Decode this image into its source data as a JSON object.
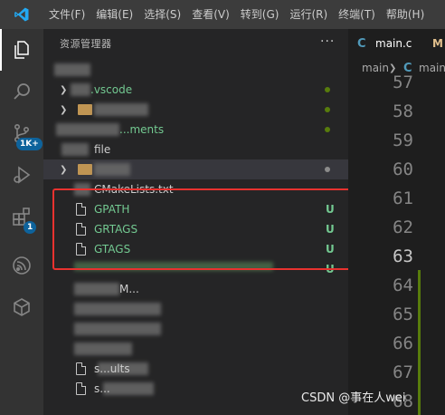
{
  "menubar": {
    "items": [
      "文件(F)",
      "编辑(E)",
      "选择(S)",
      "查看(V)",
      "转到(G)",
      "运行(R)",
      "终端(T)",
      "帮助(H)"
    ]
  },
  "activitybar": {
    "icons": [
      "explorer-icon",
      "search-icon",
      "source-control-icon",
      "run-debug-icon",
      "extensions-icon",
      "espressif-icon",
      "hexagon-icon"
    ],
    "scm_badge": "1K+",
    "extensions_badge": "1"
  },
  "sidebar": {
    "title": "资源管理器",
    "more": "···",
    "items": [
      {
        "label": ".vscode",
        "type": "folder",
        "collapsed": true,
        "status": "dot",
        "status_color": "#587c0c"
      },
      {
        "label": "",
        "type": "folder",
        "collapsed": true,
        "status": "dot",
        "status_color": "#587c0c"
      },
      {
        "label": "...ments",
        "type": "folder",
        "collapsed": true,
        "status": "dot",
        "status_color": "#587c0c"
      },
      {
        "label": "file",
        "type": "folder",
        "collapsed": false,
        "status": ""
      },
      {
        "label": "",
        "type": "folder",
        "collapsed": true,
        "status": "dot",
        "status_color": "#8b8b8b"
      },
      {
        "label": "CMakeLists.txt",
        "type": "file",
        "status": ""
      },
      {
        "label": "GPATH",
        "type": "file",
        "status": "U"
      },
      {
        "label": "GRTAGS",
        "type": "file",
        "status": "U"
      },
      {
        "label": "GTAGS",
        "type": "file",
        "status": "U"
      },
      {
        "label": "",
        "type": "file",
        "status": "U"
      },
      {
        "label": "M...",
        "type": "file",
        "status": ""
      },
      {
        "label": "",
        "type": "file",
        "status": ""
      },
      {
        "label": "",
        "type": "file",
        "status": ""
      },
      {
        "label": "",
        "type": "file",
        "status": ""
      },
      {
        "label": "s...ults",
        "type": "file",
        "status": ""
      },
      {
        "label": "s...",
        "type": "file",
        "status": ""
      }
    ]
  },
  "editor": {
    "tab": {
      "icon": "C",
      "label": "main.c",
      "modified": "M"
    },
    "breadcrumb": {
      "folder": "main",
      "icon": "C",
      "file": "main"
    },
    "line_numbers": [
      "57",
      "58",
      "59",
      "60",
      "61",
      "62",
      "63",
      "64",
      "65",
      "66",
      "67",
      "68"
    ],
    "current_line": "63"
  },
  "watermark": "CSDN @事在人wei",
  "colors": {
    "untracked": "#73c991",
    "modified": "#e2c08d",
    "c_icon": "#519aba",
    "highlight_box": "#e8322f",
    "vscode_blue": "#23a9f2"
  }
}
